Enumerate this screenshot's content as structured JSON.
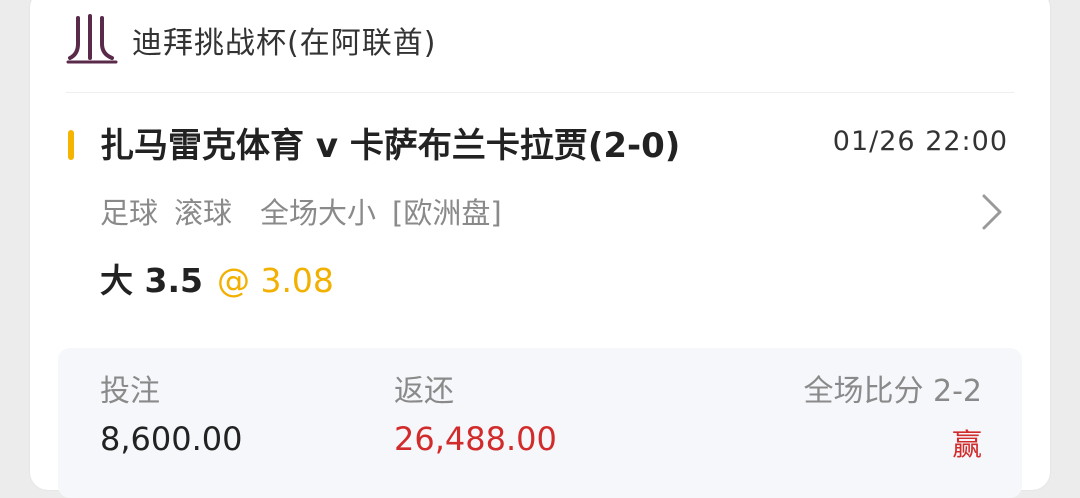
{
  "header": {
    "league_name": "迪拜挑战杯(在阿联酋)"
  },
  "match": {
    "title": "扎马雷克体育 v 卡萨布兰卡拉贾(2-0)",
    "time": "01/26 22:00"
  },
  "bet": {
    "sport": "足球",
    "mode": "滚球",
    "market": "全场大小",
    "odds_type": "[欧洲盘]",
    "pick": "大 3.5",
    "odds": "@ 3.08"
  },
  "summary": {
    "stake_label": "投注",
    "stake_value": "8,600.00",
    "return_label": "返还",
    "return_value": "26,488.00",
    "score_label": "全场比分 2-2",
    "result": "赢"
  },
  "colors": {
    "accent": "#f5b400",
    "win": "#d22b2b",
    "logo": "#5a2a4a"
  }
}
